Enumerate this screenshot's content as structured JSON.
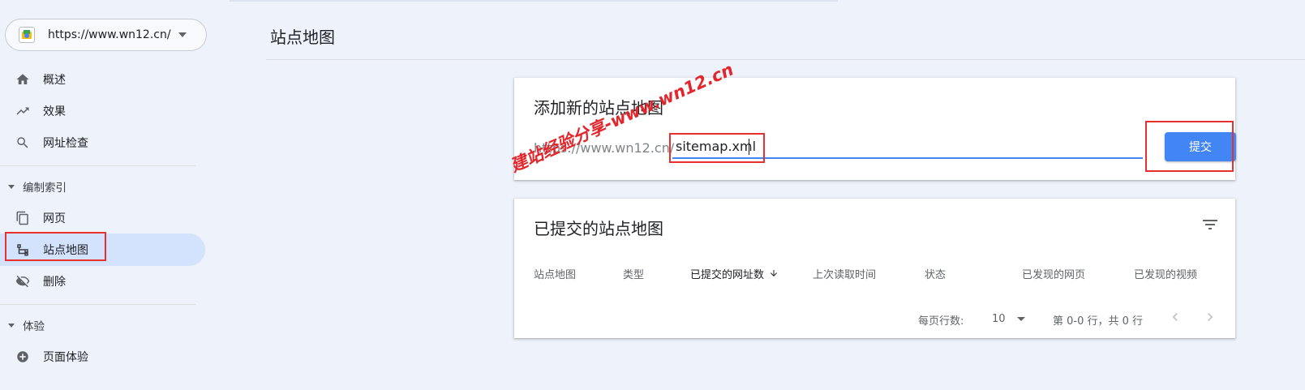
{
  "property": {
    "url": "https://www.wn12.cn/"
  },
  "nav": {
    "overview": "概述",
    "performance": "效果",
    "url_inspection": "网址检查",
    "section_index": "编制索引",
    "pages": "网页",
    "sitemaps": "站点地图",
    "removals": "删除",
    "section_experience": "体验",
    "page_experience": "页面体验"
  },
  "page": {
    "title": "站点地图"
  },
  "add_card": {
    "title": "添加新的站点地图",
    "url_prefix": "https://www.wn12.cn/",
    "input_value": "sitemap.xml",
    "submit_label": "提交"
  },
  "submitted_card": {
    "title": "已提交的站点地图",
    "columns": [
      "站点地图",
      "类型",
      "已提交的网址数",
      "上次读取时间",
      "状态",
      "已发现的网页",
      "已发现的视频"
    ],
    "rows_per_page_label": "每页行数:",
    "rows_per_page_value": "10",
    "range_text": "第 0-0 行，共 0 行"
  },
  "watermark": "建站经验分享-www.wn12.cn",
  "colors": {
    "accent": "#4285f4",
    "highlight": "#e8312f",
    "active_nav": "#d3e3fd"
  },
  "icons": [
    "home-icon",
    "trending-up-icon",
    "search-icon",
    "pages-icon",
    "sitemap-icon",
    "eye-off-icon",
    "experience-icon",
    "filter-icon",
    "arrow-down-icon",
    "chevron-left-icon",
    "chevron-right-icon"
  ]
}
